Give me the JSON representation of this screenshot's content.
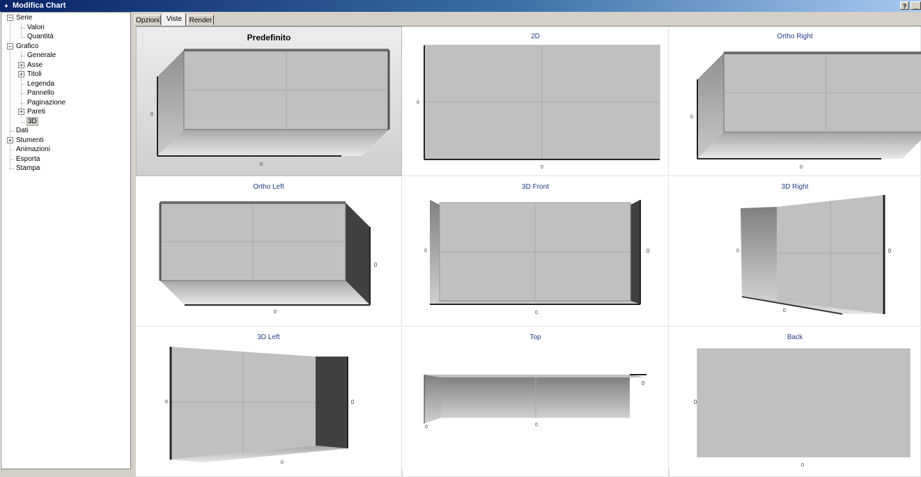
{
  "window": {
    "title": "Modifica Chart",
    "help_label": "?",
    "min_label": "_"
  },
  "tree": [
    {
      "label": "Serie",
      "level": 0,
      "expander": "−",
      "y": 0
    },
    {
      "label": "Valori",
      "level": 2,
      "y": 1
    },
    {
      "label": "Quantità",
      "level": 2,
      "y": 2
    },
    {
      "label": "Grafico",
      "level": 0,
      "expander": "−",
      "y": 3
    },
    {
      "label": "Generale",
      "level": 2,
      "y": 4
    },
    {
      "label": "Asse",
      "level": 1,
      "expander": "+",
      "y": 5
    },
    {
      "label": "Titoli",
      "level": 1,
      "expander": "+",
      "y": 6
    },
    {
      "label": "Legenda",
      "level": 2,
      "y": 7
    },
    {
      "label": "Pannello",
      "level": 2,
      "y": 8
    },
    {
      "label": "Paginazione",
      "level": 2,
      "y": 9
    },
    {
      "label": "Pareti",
      "level": 1,
      "expander": "+",
      "y": 10
    },
    {
      "label": "3D",
      "level": 2,
      "y": 11,
      "selected": true
    },
    {
      "label": "Dati",
      "level": 0,
      "y": 12
    },
    {
      "label": "Stumenti",
      "level": 0,
      "expander": "+",
      "y": 13
    },
    {
      "label": "Animazioni",
      "level": 0,
      "y": 14
    },
    {
      "label": "Esporta",
      "level": 0,
      "y": 15
    },
    {
      "label": "Stampa",
      "level": 0,
      "y": 16
    }
  ],
  "tabs": [
    "Opzioni",
    "Viste",
    "Render"
  ],
  "active_tab": "Viste",
  "views": [
    {
      "title": "Predefinito",
      "style": "default",
      "selected": true
    },
    {
      "title": "2D",
      "style": "flat"
    },
    {
      "title": "Ortho Right",
      "style": "ortho-right"
    },
    {
      "title": "Ortho Left",
      "style": "ortho-left"
    },
    {
      "title": "3D Front",
      "style": "front"
    },
    {
      "title": "3D Right",
      "style": "3d-right"
    },
    {
      "title": "3D Left",
      "style": "3d-left"
    },
    {
      "title": "Top",
      "style": "top"
    },
    {
      "title": "Back",
      "style": "back"
    }
  ],
  "axis_label": "0",
  "colors": {
    "wall": "#c0c0c0",
    "dark_wall": "#404040",
    "grid": "#a8a8a8",
    "title": "#1f3a82"
  }
}
